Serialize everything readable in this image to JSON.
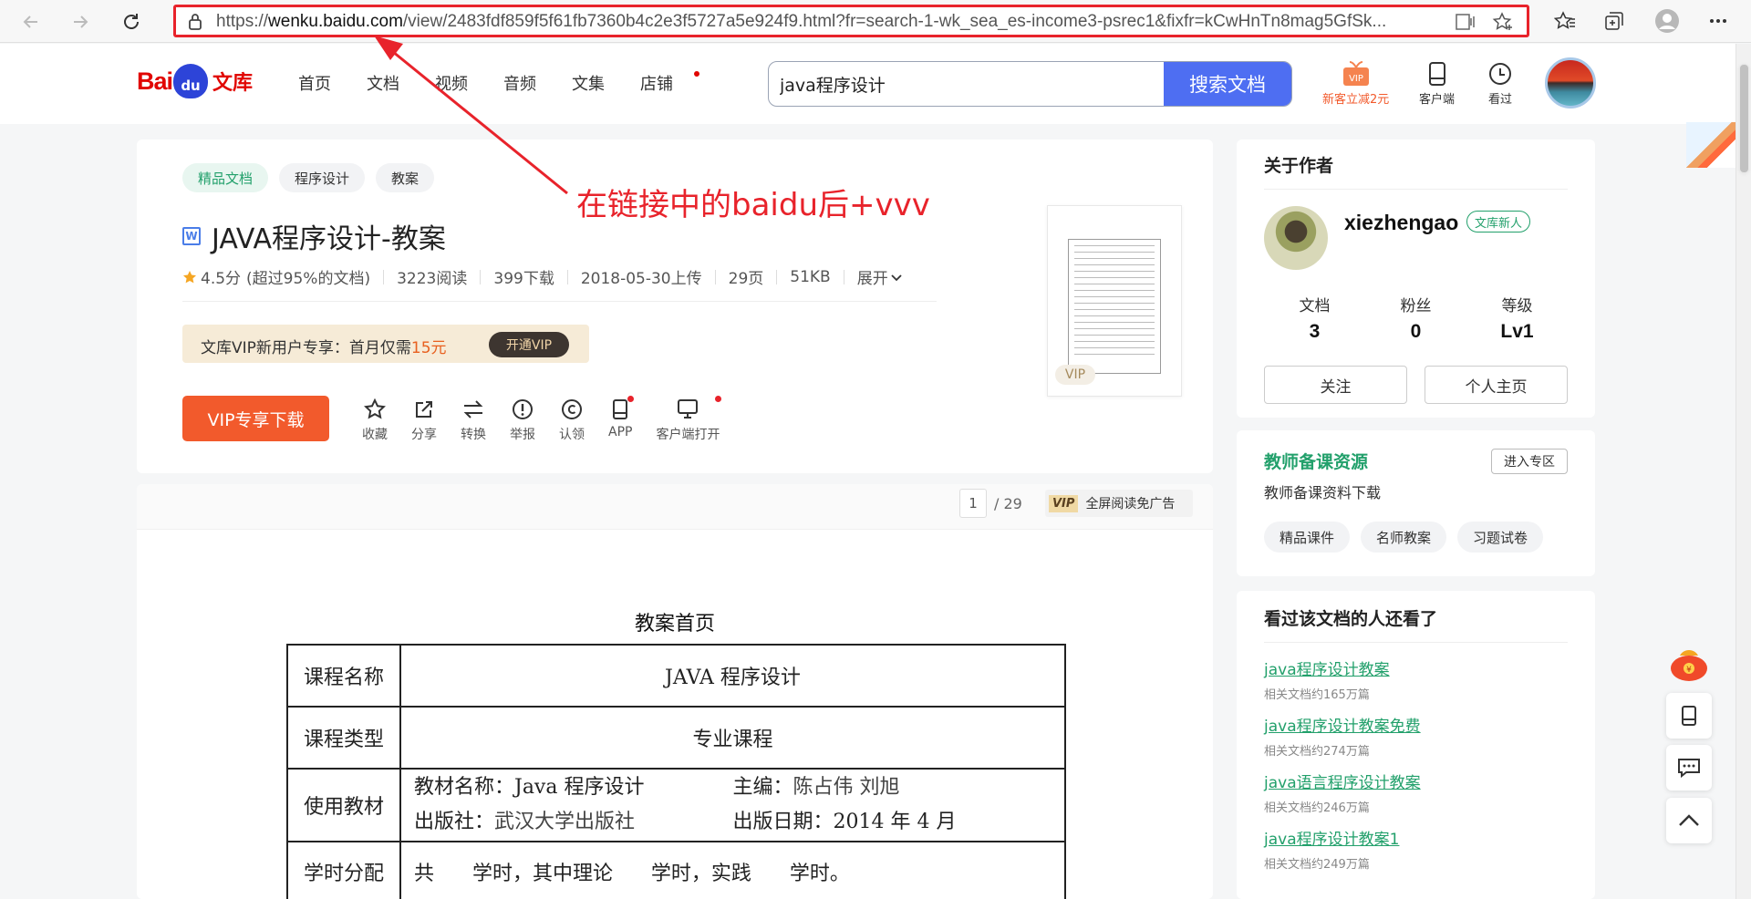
{
  "browser": {
    "url_prefix": "https://",
    "url_host": "wenku.baidu.com",
    "url_rest": "/view/2483fdf859f5f61fb7360b4c2e3f5727a5e924f9.html?fr=search-1-wk_sea_es-income3-psrec1&fixfr=kCwHnTn8mag5GfSk..."
  },
  "header": {
    "logo_bai": "Bai",
    "logo_du": "du",
    "logo_wenku": "文库",
    "nav": [
      "首页",
      "文档",
      "视频",
      "音频",
      "文集",
      "店铺"
    ],
    "search_value": "java程序设计",
    "search_button": "搜索文档",
    "promo_label": "新客立减2元",
    "promo_badge": "VIP",
    "client_label": "客户端",
    "history_label": "看过"
  },
  "doc": {
    "tags": [
      "精品文档",
      "程序设计",
      "教案"
    ],
    "word_icon": "W",
    "title": "JAVA程序设计-教案",
    "rating": "4.5分",
    "rating_note": "(超过95%的文档)",
    "reads": "3223阅读",
    "downloads": "399下载",
    "upload_date": "2018-05-30上传",
    "pages": "29页",
    "size": "51KB",
    "expand": "展开",
    "vip_promo_text": "文库VIP新用户专享：首月仅需",
    "vip_promo_price": "15元",
    "vip_open": "开通VIP",
    "download_button": "VIP专享下载",
    "actions": [
      "收藏",
      "分享",
      "转换",
      "举报",
      "认领",
      "APP",
      "客户端打开"
    ],
    "thumb_badge": "VIP"
  },
  "annotation": "在链接中的baidu后+vvv",
  "reader": {
    "current_page": "1",
    "total_pages": "/ 29",
    "fullread_badge": "VIP",
    "fullread_label": "全屏阅读免广告",
    "page_title": "教案首页",
    "rows": [
      {
        "label": "课程名称",
        "value": "JAVA 程序设计"
      },
      {
        "label": "课程类型",
        "value": "专业课程"
      },
      {
        "label": "使用教材",
        "book": "教材名称：Java 程序设计",
        "editor_label": "主编：",
        "editor": "陈占伟  刘旭",
        "publisher_label": "出版社：",
        "publisher": "武汉大学出版社",
        "date_label": "出版日期：",
        "date": "2014 年  4  月"
      },
      {
        "label": "学时分配",
        "value": "共      学时，其中理论      学时，实践      学时。"
      }
    ]
  },
  "author": {
    "section_title": "关于作者",
    "name": "xiezhengao",
    "badge": "文库新人",
    "stats": [
      {
        "label": "文档",
        "value": "3"
      },
      {
        "label": "粉丝",
        "value": "0"
      },
      {
        "label": "等级",
        "value": "Lv1"
      }
    ],
    "follow": "关注",
    "homepage": "个人主页"
  },
  "resources": {
    "title": "教师备课资源",
    "enter": "进入专区",
    "subtitle": "教师备课资料下载",
    "tags": [
      "精品课件",
      "名师教案",
      "习题试卷"
    ]
  },
  "viewed": {
    "title": "看过该文档的人还看了",
    "items": [
      {
        "title": "java程序设计教案",
        "sub": "相关文档约165万篇"
      },
      {
        "title": "java程序设计教案免费",
        "sub": "相关文档约274万篇"
      },
      {
        "title": "java语言程序设计教案",
        "sub": "相关文档约246万篇"
      },
      {
        "title": "java程序设计教案1",
        "sub": "相关文档约249万篇"
      }
    ]
  },
  "colors": {
    "accent_red": "#e8232b",
    "search_blue": "#4e6ef2",
    "download_orange": "#f25a2c",
    "brand_green": "#22a06b"
  }
}
